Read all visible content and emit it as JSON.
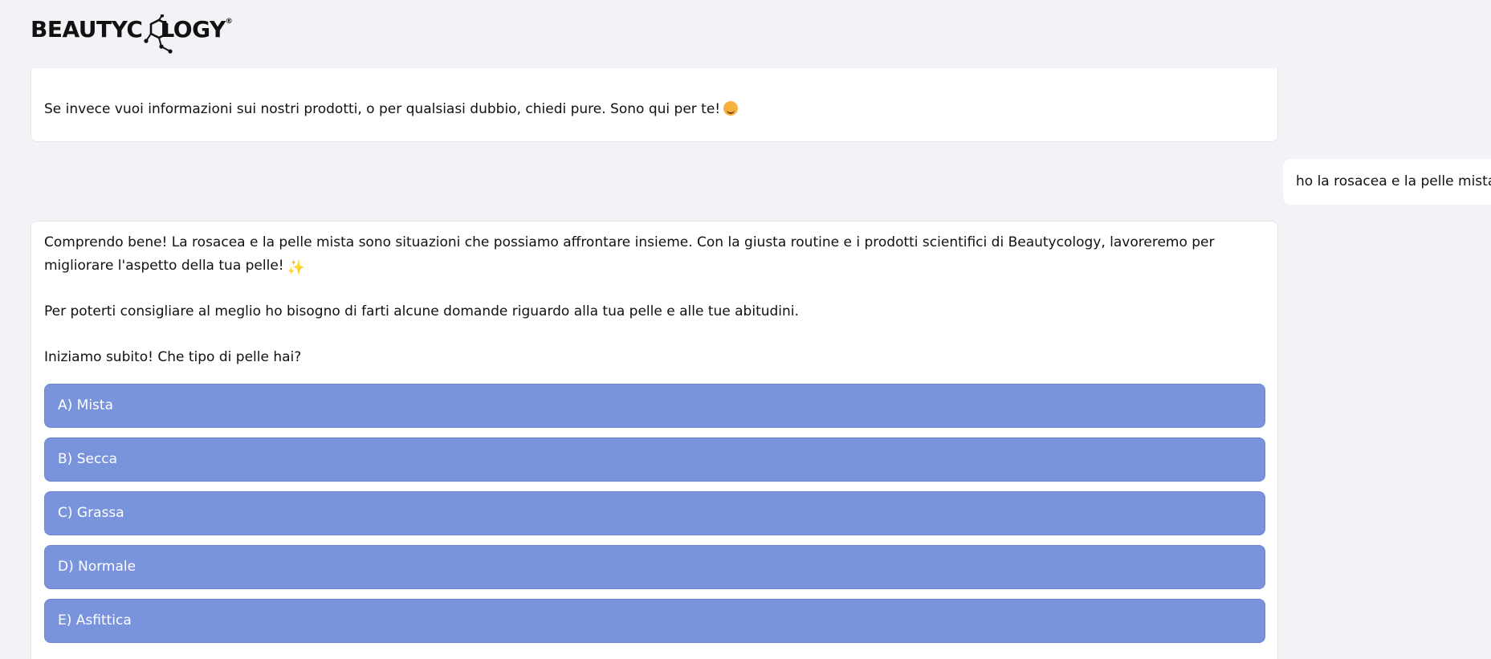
{
  "brand": {
    "logo_text_a": "BEAUTYC",
    "logo_text_b": "LOGY",
    "logo_mark": "®"
  },
  "messages": {
    "bot_1": {
      "text": "Se invece vuoi informazioni sui nostri prodotti, o per qualsiasi dubbio, chiedi pure. Sono qui per te!",
      "emoji": "smiling-face-icon"
    },
    "user_1": {
      "text": "ho la rosacea e la pelle mista"
    },
    "bot_2": {
      "p1": "Comprendo bene! La rosacea e la pelle mista sono situazioni che possiamo affrontare insieme. Con la giusta routine e i prodotti scientifici di Beautycology, lavoreremo per migliorare l'aspetto della tua pelle!",
      "p1_emoji": "sparkles-icon",
      "p2": "Per poterti consigliare al meglio ho bisogno di farti alcune domande riguardo alla tua pelle e alle tue abitudini.",
      "p3": "Iniziamo subito! Che tipo di pelle hai?",
      "options": [
        {
          "label": "A) Mista"
        },
        {
          "label": "B) Secca"
        },
        {
          "label": "C) Grassa"
        },
        {
          "label": "D) Normale"
        },
        {
          "label": "E) Asfittica"
        }
      ]
    }
  },
  "colors": {
    "background": "#f2f3f6",
    "bubble": "#ffffff",
    "option_button": "#7993dc",
    "option_text": "#ffffff"
  }
}
